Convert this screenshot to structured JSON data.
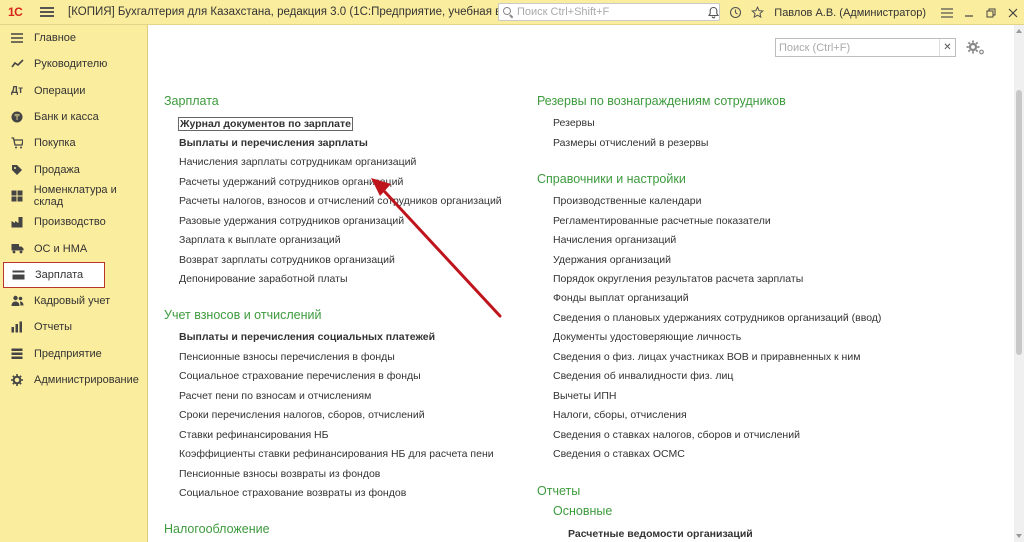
{
  "titlebar": {
    "logo": "1С",
    "title": "[КОПИЯ] Бухгалтерия для Казахстана, редакция 3.0  (1С:Предприятие, учебная версия)",
    "search_placeholder": "Поиск Ctrl+Shift+F",
    "user": "Павлов А.В. (Администратор)"
  },
  "sidebar": {
    "items": [
      {
        "label": "Главное",
        "icon": "menu-icon"
      },
      {
        "label": "Руководителю",
        "icon": "chart-icon"
      },
      {
        "label": "Операции",
        "icon": "operations-icon"
      },
      {
        "label": "Банк и касса",
        "icon": "bank-icon"
      },
      {
        "label": "Покупка",
        "icon": "cart-icon"
      },
      {
        "label": "Продажа",
        "icon": "sale-icon"
      },
      {
        "label": "Номенклатура и склад",
        "icon": "warehouse-icon"
      },
      {
        "label": "Производство",
        "icon": "production-icon"
      },
      {
        "label": "ОС и НМА",
        "icon": "truck-icon"
      },
      {
        "label": "Зарплата",
        "icon": "salary-icon",
        "active": true
      },
      {
        "label": "Кадровый учет",
        "icon": "people-icon"
      },
      {
        "label": "Отчеты",
        "icon": "reports-icon"
      },
      {
        "label": "Предприятие",
        "icon": "enterprise-icon"
      },
      {
        "label": "Администрирование",
        "icon": "admin-gear-icon"
      }
    ]
  },
  "main": {
    "search_placeholder": "Поиск (Ctrl+F)",
    "left": {
      "salary": {
        "title": "Зарплата",
        "links": [
          "Журнал документов по зарплате",
          "Выплаты и перечисления зарплаты",
          "Начисления зарплаты сотрудникам организаций",
          "Расчеты удержаний сотрудников организаций",
          "Расчеты налогов, взносов и отчислений сотрудников организаций",
          "Разовые удержания сотрудников организаций",
          "Зарплата к выплате организаций",
          "Возврат зарплаты сотрудников организаций",
          "Депонирование заработной платы"
        ]
      },
      "contrib": {
        "title": "Учет взносов и отчислений",
        "links": [
          "Выплаты и перечисления социальных платежей",
          "Пенсионные взносы перечисления в фонды",
          "Социальное страхование перечисления в фонды",
          "Расчет пени по взносам и отчислениям",
          "Сроки перечисления налогов, сборов, отчислений",
          "Ставки рефинансирования НБ",
          "Коэффициенты ставки рефинансирования НБ для расчета пени",
          "Пенсионные взносы возвраты из фондов",
          "Социальное страхование возвраты из фондов"
        ]
      },
      "tax": {
        "title": "Налогообложение"
      }
    },
    "right": {
      "reserves": {
        "title": "Резервы по вознаграждениям сотрудников",
        "links": [
          "Резервы",
          "Размеры отчислений в резервы"
        ]
      },
      "settings": {
        "title": "Справочники и настройки",
        "links": [
          "Производственные календари",
          "Регламентированные расчетные показатели",
          "Начисления организаций",
          "Удержания организаций",
          "Порядок округления результатов расчета зарплаты",
          "Фонды выплат организаций",
          "Сведения о плановых удержаниях сотрудников организаций (ввод)",
          "Документы удостоверяющие личность",
          "Сведения о физ. лицах участниках ВОВ и приравненных к ним",
          "Сведения об инвалидности физ. лиц",
          "Вычеты ИПН",
          "Налоги, сборы, отчисления",
          "Сведения о ставках налогов, сборов и отчислений",
          "Сведения о ставках ОСМС"
        ]
      },
      "reports": {
        "title": "Отчеты",
        "subtitle": "Основные",
        "links": [
          "Расчетные ведомости организаций"
        ]
      }
    }
  },
  "colors": {
    "accent_green": "#3d9b3d",
    "sidebar_bg": "#fbed9e",
    "arrow_red": "#c0141c",
    "active_border": "#b9342a"
  }
}
